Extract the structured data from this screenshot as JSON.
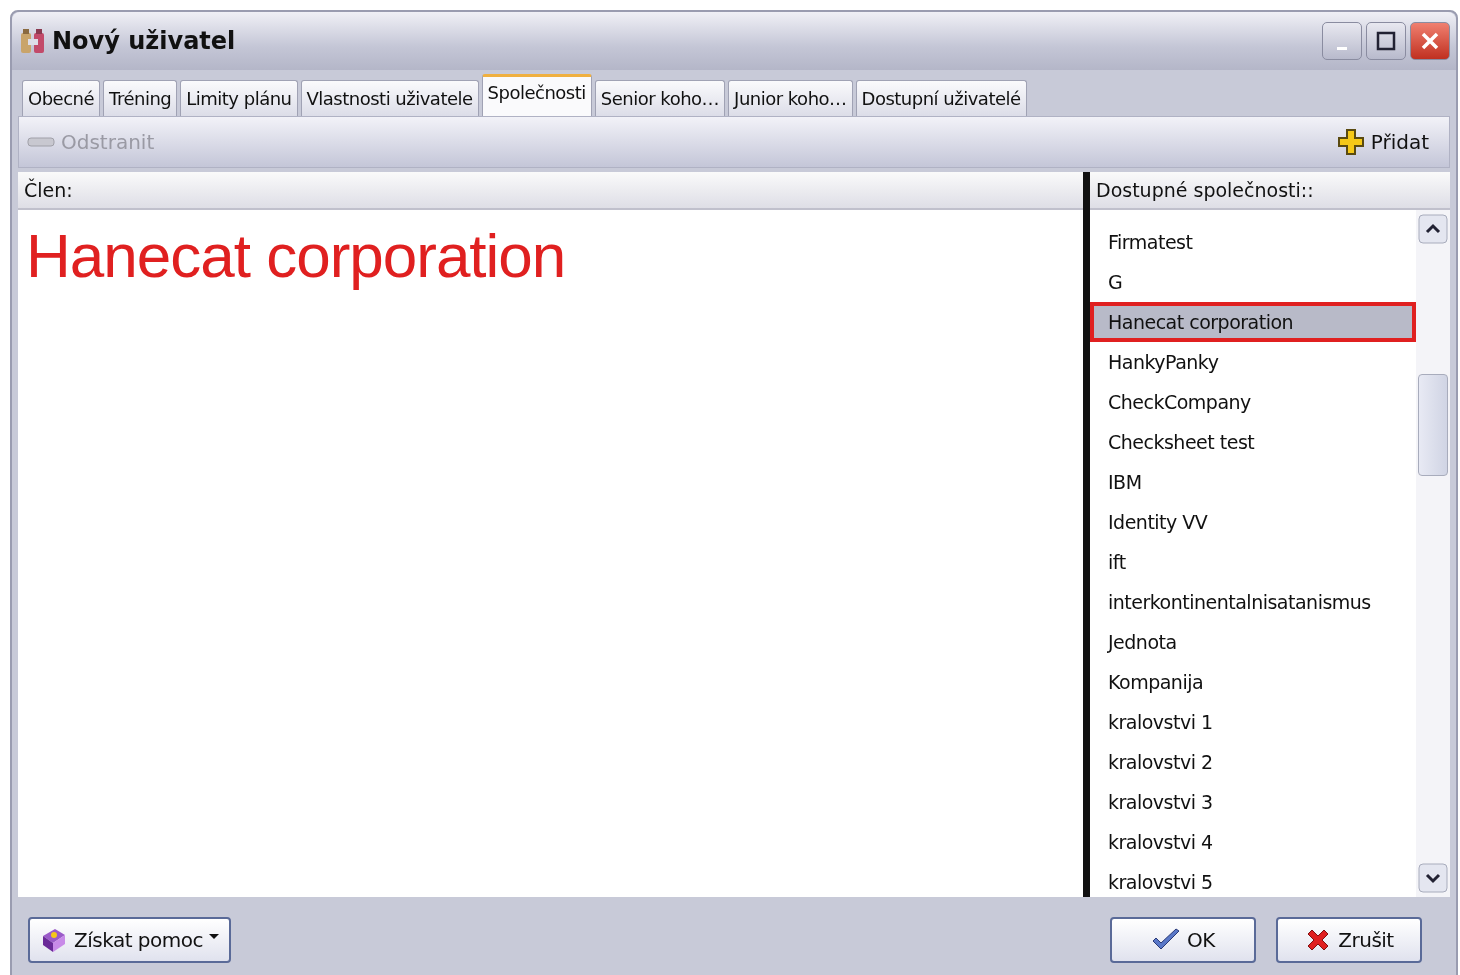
{
  "window": {
    "title": "Nový uživatel"
  },
  "tabs": [
    {
      "label": "Obecné",
      "selected": false
    },
    {
      "label": "Tréning",
      "selected": false
    },
    {
      "label": "Limity plánu",
      "selected": false
    },
    {
      "label": "Vlastnosti uživatele",
      "selected": false
    },
    {
      "label": "Společnosti",
      "selected": true
    },
    {
      "label": "Senior koho…",
      "selected": false
    },
    {
      "label": "Junior koho…",
      "selected": false
    },
    {
      "label": "Dostupní uživatelé",
      "selected": false
    }
  ],
  "toolbar": {
    "remove": {
      "label": "Odstranit",
      "disabled": true
    },
    "add": {
      "label": "Přidat",
      "disabled": false
    }
  },
  "member_panel": {
    "header": "Člen:",
    "member": "Hanecat corporation"
  },
  "available_panel": {
    "header": "Dostupné společnosti::",
    "items": [
      {
        "label": "Firmatest",
        "selected": false
      },
      {
        "label": "G",
        "selected": false
      },
      {
        "label": "Hanecat corporation",
        "selected": true
      },
      {
        "label": "HankyPanky",
        "selected": false
      },
      {
        "label": "CheckCompany",
        "selected": false
      },
      {
        "label": "Checksheet test",
        "selected": false
      },
      {
        "label": "IBM",
        "selected": false
      },
      {
        "label": "Identity VV",
        "selected": false
      },
      {
        "label": "ift",
        "selected": false
      },
      {
        "label": "interkontinentalnisatanismus",
        "selected": false
      },
      {
        "label": "Jednota",
        "selected": false
      },
      {
        "label": "Kompanija",
        "selected": false
      },
      {
        "label": "kralovstvi 1",
        "selected": false
      },
      {
        "label": "kralovstvi 2",
        "selected": false
      },
      {
        "label": "kralovstvi 3",
        "selected": false
      },
      {
        "label": "kralovstvi 4",
        "selected": false
      },
      {
        "label": "kralovstvi 5",
        "selected": false
      }
    ]
  },
  "buttons": {
    "help": "Získat pomoc",
    "ok": "OK",
    "cancel": "Zrušit"
  }
}
